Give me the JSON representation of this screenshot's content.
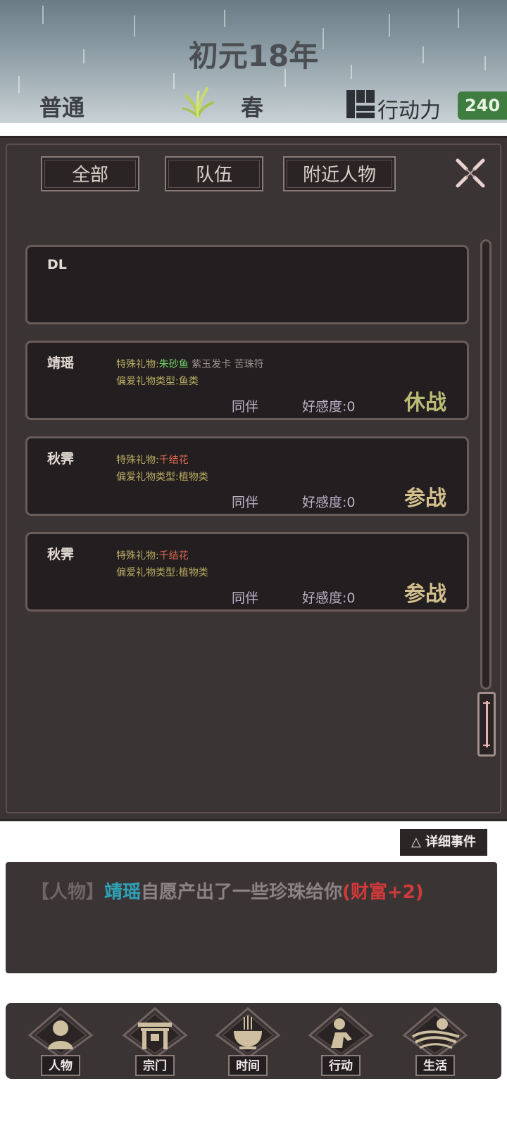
{
  "header": {
    "year_title": "初元18年",
    "difficulty": "普通",
    "season_icon": "grass-sprout-icon",
    "season": "春",
    "action_points_icon": "action-blocks-icon",
    "action_points_label": "行动力",
    "action_points_value": "240"
  },
  "tabs": [
    {
      "label": "全部"
    },
    {
      "label": "队伍"
    },
    {
      "label": "附近人物"
    }
  ],
  "close_icon": "close-icon",
  "player_card": {
    "name": "DL"
  },
  "companions": [
    {
      "name": "靖瑶",
      "special_gift_prefix": "特殊礼物:",
      "special_gift_main": "朱砂鱼",
      "special_gift_others": " 紫玉发卡 苦珠符",
      "preferred_gift_type": "偏爱礼物类型:鱼类",
      "relation": "同伴",
      "favor": "好感度:0",
      "battle_status": "休战"
    },
    {
      "name": "秋霁",
      "special_gift_prefix": "特殊礼物:",
      "special_gift_main": "千结花",
      "special_gift_others": "",
      "preferred_gift_type": "偏爱礼物类型:植物类",
      "relation": "同伴",
      "favor": "好感度:0",
      "battle_status": "参战"
    },
    {
      "name": "秋霁",
      "special_gift_prefix": "特殊礼物:",
      "special_gift_main": "千结花",
      "special_gift_others": "",
      "preferred_gift_type": "偏爱礼物类型:植物类",
      "relation": "同伴",
      "favor": "好感度:0",
      "battle_status": "参战"
    }
  ],
  "event_log": {
    "detail_button": "△ 详细事件",
    "entries": [
      {
        "tag": "【人物】",
        "name": "靖瑶",
        "text": "自愿产出了一些珍珠给你",
        "reward": "(财富+2)"
      }
    ]
  },
  "bottom_nav": [
    {
      "label": "人物",
      "icon": "person-icon"
    },
    {
      "label": "宗门",
      "icon": "sect-gate-icon"
    },
    {
      "label": "时间",
      "icon": "incense-burner-icon"
    },
    {
      "label": "行动",
      "icon": "action-figure-icon"
    },
    {
      "label": "生活",
      "icon": "landscape-sun-icon"
    }
  ],
  "colors": {
    "panel_bg": "#3b3434",
    "card_bg": "#231e1f",
    "accent_green": "#3e7d3f",
    "gift_highlight_green": "#6fd06a",
    "gift_highlight_red": "#e06a52",
    "log_name": "#2ea3b8",
    "log_reward": "#d03a3a"
  }
}
